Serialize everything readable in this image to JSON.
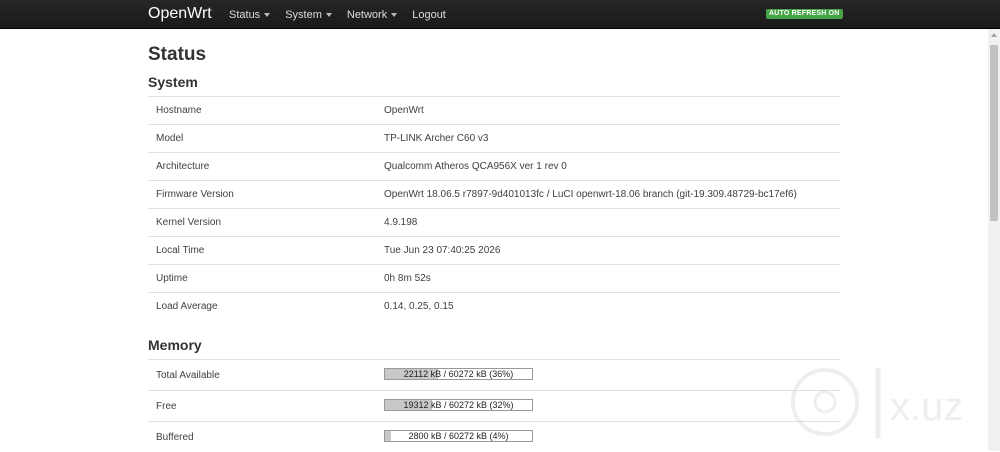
{
  "header": {
    "brand": "OpenWrt",
    "menu": [
      {
        "label": "Status",
        "has_caret": true
      },
      {
        "label": "System",
        "has_caret": true
      },
      {
        "label": "Network",
        "has_caret": true
      },
      {
        "label": "Logout",
        "has_caret": false
      }
    ],
    "auto_refresh_label": "AUTO REFRESH ON",
    "auto_refresh_color": "#47a447"
  },
  "page_title": "Status",
  "system": {
    "title": "System",
    "rows": [
      {
        "label": "Hostname",
        "value": "OpenWrt"
      },
      {
        "label": "Model",
        "value": "TP-LINK Archer C60 v3"
      },
      {
        "label": "Architecture",
        "value": "Qualcomm Atheros QCA956X ver 1 rev 0"
      },
      {
        "label": "Firmware Version",
        "value": "OpenWrt 18.06.5 r7897-9d401013fc / LuCI openwrt-18.06 branch (git-19.309.48729-bc17ef6)"
      },
      {
        "label": "Kernel Version",
        "value": "4.9.198"
      },
      {
        "label": "Local Time",
        "value": "Tue Jun 23 07:40:25 2026"
      },
      {
        "label": "Uptime",
        "value": "0h 8m 52s"
      },
      {
        "label": "Load Average",
        "value": "0.14, 0.25, 0.15"
      }
    ]
  },
  "memory": {
    "title": "Memory",
    "rows": [
      {
        "label": "Total Available",
        "bar_text": "22112 kB / 60272 kB (36%)",
        "percent": 36
      },
      {
        "label": "Free",
        "bar_text": "19312 kB / 60272 kB (32%)",
        "percent": 32
      },
      {
        "label": "Buffered",
        "bar_text": "2800 kB / 60272 kB (4%)",
        "percent": 4
      }
    ]
  },
  "watermark": {
    "text": "x.uz"
  }
}
